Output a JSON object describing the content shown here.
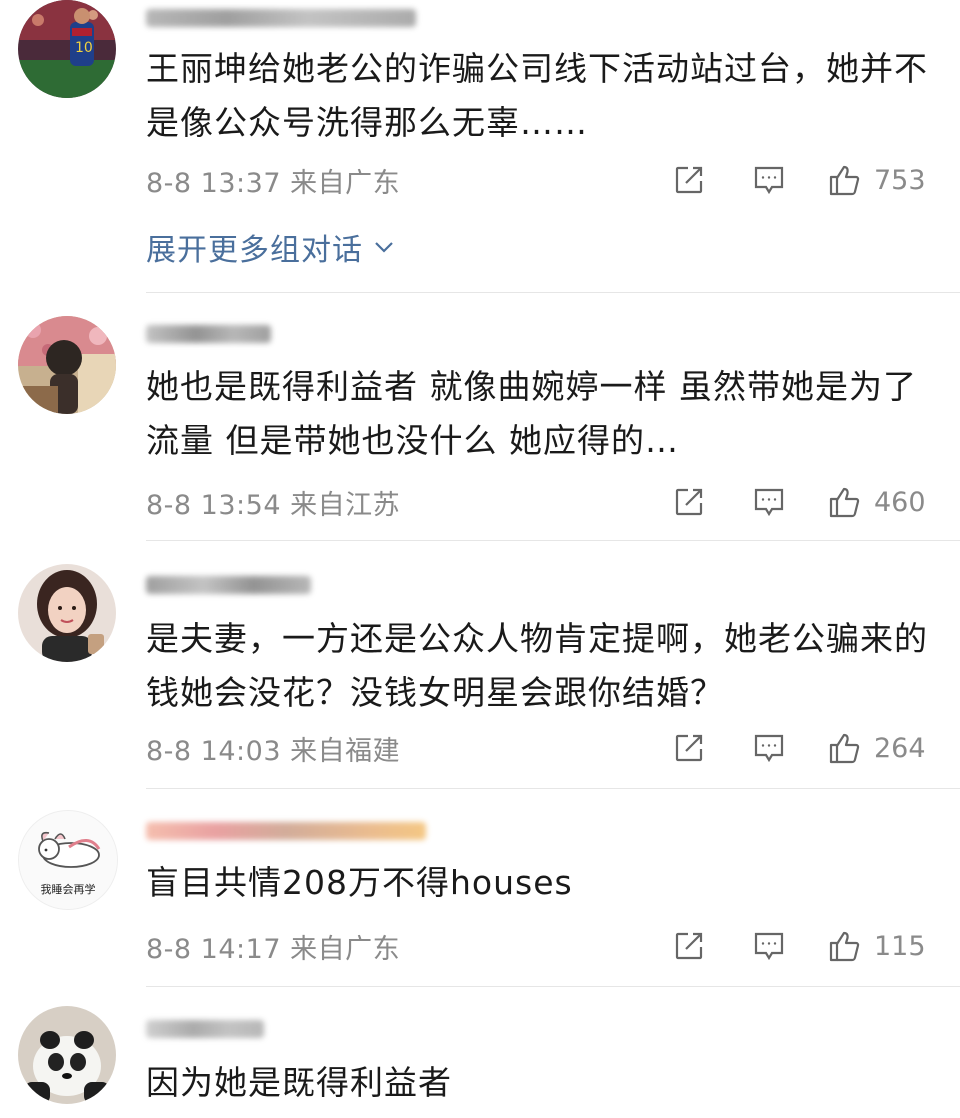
{
  "comments": [
    {
      "text": "王丽坤给她老公的诈骗公司线下活动站过台，她并不是像公众号洗得那么无辜……",
      "time": "8-8 13:37",
      "location": "来自广东",
      "likes": "753",
      "expand_label": "展开更多组对话"
    },
    {
      "text": "她也是既得利益者  就像曲婉婷一样  虽然带她是为了流量  但是带她也没什么  她应得的…",
      "time": "8-8 13:54",
      "location": "来自江苏",
      "likes": "460"
    },
    {
      "text": "是夫妻，一方还是公众人物肯定提啊，她老公骗来的钱她会没花？没钱女明星会跟你结婚？",
      "time": "8-8 14:03",
      "location": "来自福建",
      "likes": "264"
    },
    {
      "text": "盲目共情208万不得houses",
      "time": "8-8 14:17",
      "location": "来自广东",
      "likes": "115",
      "avatar_text": "我睡会再学"
    },
    {
      "text": "因为她是既得利益者"
    }
  ],
  "icons": {
    "share": "share-icon",
    "reply": "comment-icon",
    "like": "thumbs-up-icon",
    "expand": "chevron-down-icon"
  },
  "colors": {
    "link": "#4a6f9c",
    "meta": "#8a8a8a",
    "text": "#1a1a1a"
  }
}
